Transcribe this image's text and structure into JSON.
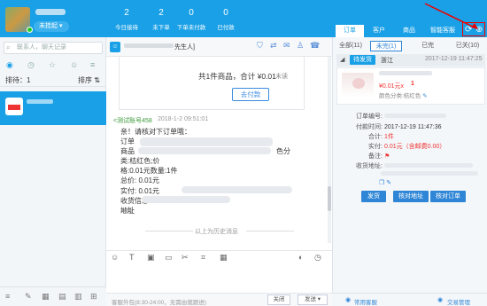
{
  "header": {
    "status": "未挂起 ▾",
    "stats": [
      {
        "value": "2",
        "label": "今日接待"
      },
      {
        "value": "2",
        "label": "未下单"
      },
      {
        "value": "0",
        "label": "下单未付款"
      },
      {
        "value": "0",
        "label": "已付款"
      }
    ]
  },
  "right_tabs": [
    "订单",
    "客户",
    "商品",
    "智能客服"
  ],
  "left_panel": {
    "search_placeholder": "联系人，聊天记录",
    "sort_label": "排待：1",
    "sort_toggle": "排序 ⇅"
  },
  "chat": {
    "title_suffix": "先生人]",
    "order_card": {
      "total": "共1件商品，合计 ¥0.01",
      "unpaid": "未读",
      "pay_button": "去付款"
    },
    "message": {
      "sender": "<测试账号458",
      "time": "2018-1-2 09:51:01",
      "lines": [
        "亲！请核对下订单哦：",
        "订单",
        "商品",
        "格:0.01元数量:1件",
        "总价: 0.01元",
        "实付: 0.01元",
        "收货信息:",
        "地址"
      ],
      "line3_suffix": "色分类:桔红色;价",
      "read_status": "未读"
    },
    "history_text": "以上为历史消息",
    "footer": {
      "hours": "客服外包(8:30-24:00，无需由我跟进)",
      "close": "关闭",
      "send": "发送 ▾"
    }
  },
  "right_panel": {
    "filters": [
      "全部(11)",
      "未完(1)",
      "已完",
      "已关(10)"
    ],
    "order": {
      "status": "待发货",
      "region": "浙江",
      "time": "2017-12-19 11:47:25",
      "price": "¥0.01元x",
      "qty": "1",
      "variant": "颜色分类:桔红色",
      "details": [
        {
          "label": "订单编号:",
          "value": ""
        },
        {
          "label": "付款时间:",
          "value": "2017-12-19 11:47:36"
        },
        {
          "label": "合计:",
          "value": "1件"
        },
        {
          "label": "实付:",
          "value": "0.01元（含邮费0.00）"
        },
        {
          "label": "备注:",
          "value": ""
        },
        {
          "label": "收货地址:",
          "value": ""
        }
      ],
      "buttons": [
        "发货",
        "核对地址",
        "核对订单"
      ]
    },
    "footer": {
      "help": "常用客服",
      "trade": "交易管理"
    }
  }
}
